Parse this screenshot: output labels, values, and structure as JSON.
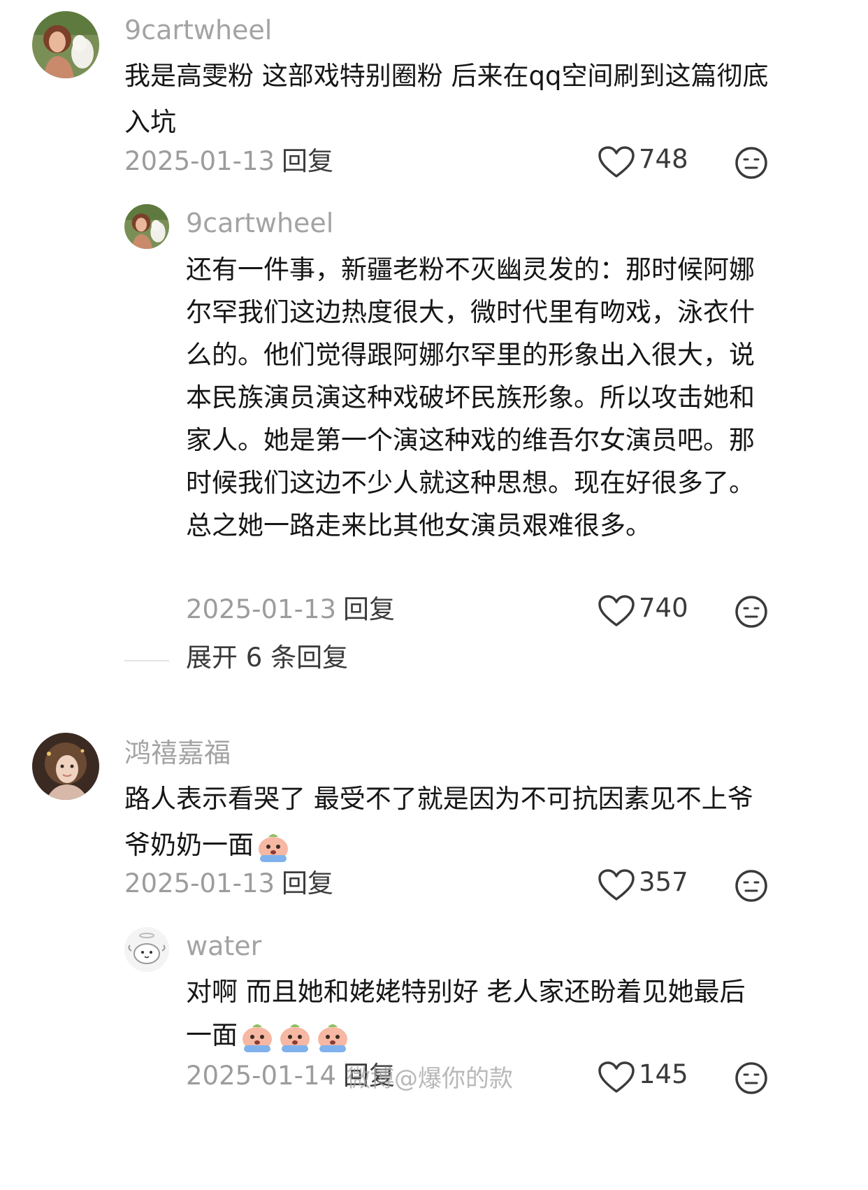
{
  "comments": [
    {
      "username": "9cartwheel",
      "text": "我是高雯粉 这部戏特别圈粉 后来在qq空间刷到这篇彻底入坑",
      "date": "2025-01-13",
      "reply_label": "回复",
      "likes": "748",
      "replies": [
        {
          "username": "9cartwheel",
          "text": "还有一件事，新疆老粉不灭幽灵发的：那时候阿娜尔罕我们这边热度很大，微时代里有吻戏，泳衣什么的。他们觉得跟阿娜尔罕里的形象出入很大，说本民族演员演这种戏破坏民族形象。所以攻击她和家人。她是第一个演这种戏的维吾尔女演员吧。那时候我们这边不少人就这种思想。现在好很多了。总之她一路走来比其他女演员艰难很多。",
          "date": "2025-01-13",
          "reply_label": "回复",
          "likes": "740"
        }
      ],
      "expand_label": "展开 6 条回复"
    },
    {
      "username": "鸿禧嘉福",
      "text": "路人表示看哭了 最受不了就是因为不可抗因素见不上爷爷奶奶一面",
      "emoji": "crying-face-emoji",
      "date": "2025-01-13",
      "reply_label": "回复",
      "likes": "357",
      "replies": [
        {
          "username": "water",
          "text": "对啊 而且她和姥姥特别好 老人家还盼着见她最后一面",
          "emoji_count": 3,
          "date": "2025-01-14",
          "reply_label": "回复",
          "likes": "145"
        }
      ]
    }
  ],
  "watermark": "微博@爆你的款",
  "colors": {
    "text": "#161616",
    "meta": "#9c9c9c",
    "username": "#a3a3a3",
    "emoji_pink": "#f6b7a3",
    "emoji_blue": "#7fb2ec"
  }
}
